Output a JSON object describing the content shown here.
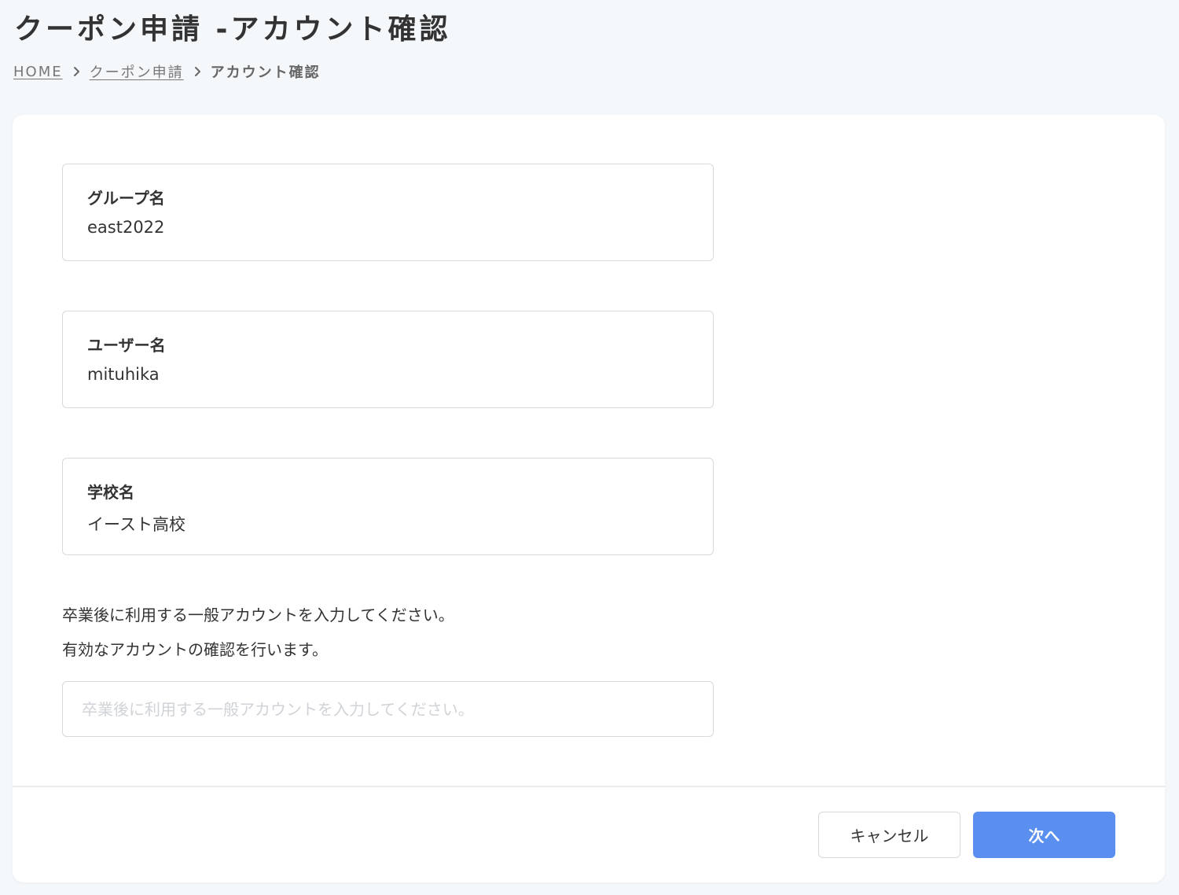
{
  "header": {
    "title": "クーポン申請 -アカウント確認"
  },
  "breadcrumb": {
    "items": [
      {
        "label": "HOME"
      },
      {
        "label": "クーポン申請"
      },
      {
        "label": "アカウント確認"
      }
    ]
  },
  "fields": {
    "group": {
      "label": "グループ名",
      "value": "east2022"
    },
    "user": {
      "label": "ユーザー名",
      "value": "mituhika"
    },
    "school": {
      "label": "学校名",
      "value": "イースト高校"
    }
  },
  "instructions": {
    "line1": "卒業後に利用する一般アカウントを入力してください。",
    "line2": "有効なアカウントの確認を行います。"
  },
  "account_input": {
    "value": "",
    "placeholder": "卒業後に利用する一般アカウントを入力してください。"
  },
  "actions": {
    "cancel_label": "キャンセル",
    "next_label": "次へ"
  },
  "colors": {
    "primary": "#5a8ff0",
    "background": "#f5f8fb",
    "border": "#d6d9dd"
  },
  "icons": {
    "breadcrumb_separator": "chevron-right-icon"
  }
}
